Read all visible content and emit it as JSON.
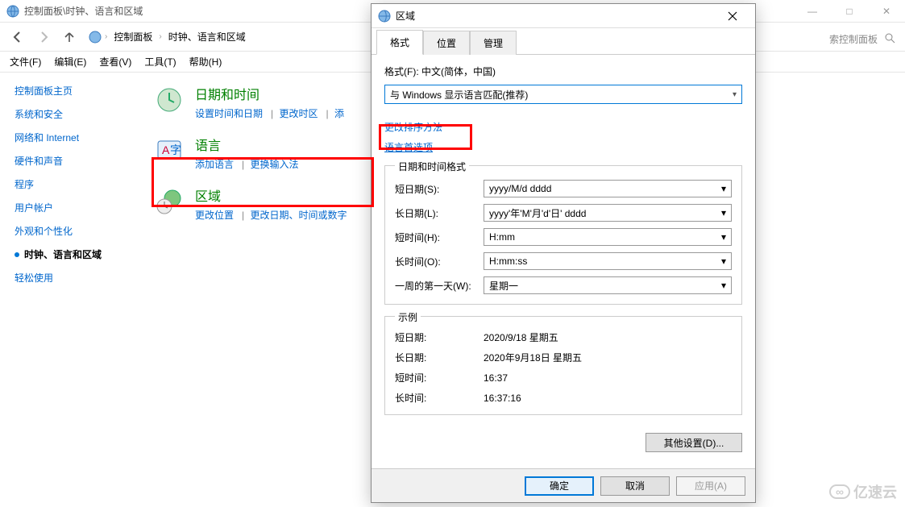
{
  "main_window": {
    "title": "控制面板\\时钟、语言和区域",
    "win_min": "—",
    "win_max": "□",
    "win_close": "✕",
    "breadcrumb": {
      "root_icon": "◳",
      "sep": "›",
      "item1": "控制面板",
      "item2": "时钟、语言和区域"
    },
    "search_hint": "索控制面板",
    "menu": {
      "file": "文件(F)",
      "edit": "编辑(E)",
      "view": "查看(V)",
      "tools": "工具(T)",
      "help": "帮助(H)"
    }
  },
  "sidebar": {
    "home": "控制面板主页",
    "items": [
      "系统和安全",
      "网络和 Internet",
      "硬件和声音",
      "程序",
      "用户帐户",
      "外观和个性化"
    ],
    "active": "时钟、语言和区域",
    "last": "轻松使用"
  },
  "content": {
    "cat1": {
      "title": "日期和时间",
      "l1": "设置时间和日期",
      "l2": "更改时区",
      "l3": "添"
    },
    "cat2": {
      "title": "语言",
      "l1": "添加语言",
      "l2": "更换输入法"
    },
    "cat3": {
      "title": "区域",
      "l1": "更改位置",
      "l2": "更改日期、时间或数字"
    }
  },
  "dialog": {
    "title": "区域",
    "tabs": {
      "format": "格式",
      "location": "位置",
      "admin": "管理"
    },
    "format_label": "格式(F): 中文(简体，中国)",
    "format_combo": "与 Windows 显示语言匹配(推荐)",
    "sort_link": "更改排序方法",
    "lang_pref_link": "语言首选项",
    "dt_group": "日期和时间格式",
    "short_date_lbl": "短日期(S):",
    "short_date_val": "yyyy/M/d dddd",
    "long_date_lbl": "长日期(L):",
    "long_date_val": "yyyy'年'M'月'd'日' dddd",
    "short_time_lbl": "短时间(H):",
    "short_time_val": "H:mm",
    "long_time_lbl": "长时间(O):",
    "long_time_val": "H:mm:ss",
    "first_day_lbl": "一周的第一天(W):",
    "first_day_val": "星期一",
    "example_title": "示例",
    "ex_sd_lbl": "短日期:",
    "ex_sd_val": "2020/9/18 星期五",
    "ex_ld_lbl": "长日期:",
    "ex_ld_val": "2020年9月18日 星期五",
    "ex_st_lbl": "短时间:",
    "ex_st_val": "16:37",
    "ex_lt_lbl": "长时间:",
    "ex_lt_val": "16:37:16",
    "other_settings": "其他设置(D)...",
    "ok": "确定",
    "cancel": "取消",
    "apply": "应用(A)"
  },
  "watermark": "亿速云"
}
